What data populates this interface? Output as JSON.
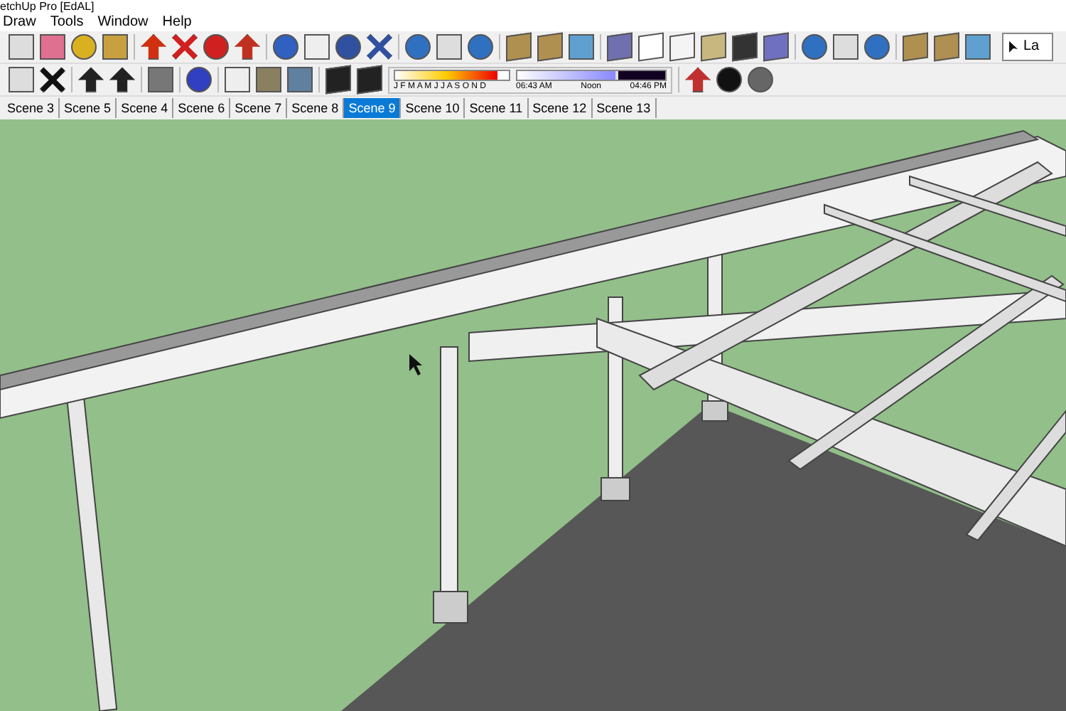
{
  "window": {
    "title": "etchUp Pro [EdAL]"
  },
  "menu": [
    "Draw",
    "Tools",
    "Window",
    "Help"
  ],
  "shadow_settings": {
    "date_slider": {
      "months": "J F M A M J J A S O N D",
      "level": 0.9
    },
    "time_slider": {
      "time_start": "06:43 AM",
      "time_mid": "Noon",
      "time_end": "04:46 PM",
      "level": 0.66
    }
  },
  "layers_dropdown": {
    "value": "La"
  },
  "scene_tabs": [
    {
      "label": "Scene 3",
      "selected": false
    },
    {
      "label": "Scene 5",
      "selected": false
    },
    {
      "label": "Scene 4",
      "selected": false
    },
    {
      "label": "Scene 6",
      "selected": false
    },
    {
      "label": "Scene 7",
      "selected": false
    },
    {
      "label": "Scene 8",
      "selected": false
    },
    {
      "label": "Scene 9",
      "selected": true
    },
    {
      "label": "Scene 10",
      "selected": false
    },
    {
      "label": "Scene 11",
      "selected": false
    },
    {
      "label": "Scene 12",
      "selected": false
    },
    {
      "label": "Scene 13",
      "selected": false
    }
  ]
}
